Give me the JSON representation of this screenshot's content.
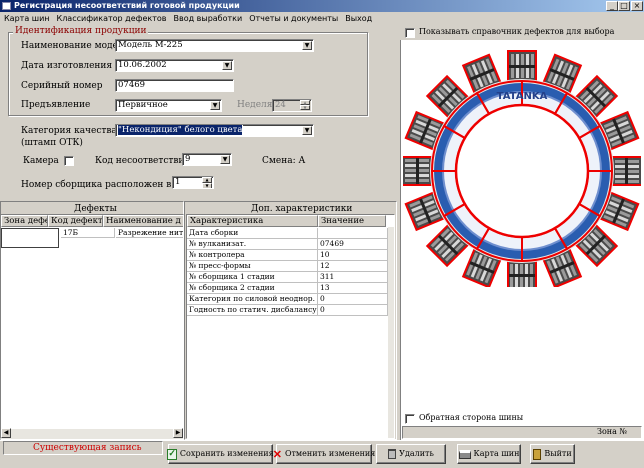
{
  "window": {
    "title": "Регистрация несоответствий готовой продукции",
    "controls": [
      "_",
      "□",
      "×"
    ]
  },
  "menu": [
    "Карта шин",
    "Классификатор дефектов",
    "Ввод выработки",
    "Отчеты и документы",
    "Выход"
  ],
  "identification": {
    "legend": "Идентификация продукции",
    "model_label": "Наименование модели",
    "model_value": "Модель М-225",
    "date_label": "Дата изготовления",
    "date_value": "10.06.2002",
    "serial_label": "Серийный номер",
    "serial_value": "07469",
    "presentation_label": "Предъявление",
    "presentation_value": "Первичное",
    "week_label": "Неделя",
    "week_value": "24"
  },
  "quality": {
    "label_line1": "Категория качества",
    "label_line2": "(штамп ОТК)",
    "value": "\"Некондиция\" белого цвета"
  },
  "camera_label": "Камера",
  "nonconformity": {
    "label": "Код несоответствия",
    "value": "9"
  },
  "shift_label": "Смена: А",
  "assembler": {
    "label": "Номер сборщика расположен в зоне",
    "value": "1"
  },
  "defects": {
    "title": "Дефекты",
    "columns": [
      "Зона дефекта",
      "Код дефекта",
      "Наименование д"
    ],
    "rows": [
      [
        "",
        "17Б",
        "Разрежение нитей"
      ]
    ]
  },
  "extra": {
    "title": "Доп. характеристики",
    "columns": [
      "Характеристика",
      "Значение"
    ],
    "rows": [
      [
        "Дата сборки",
        ""
      ],
      [
        "№ вулканизат.",
        "07469"
      ],
      [
        "№ контролера",
        "10"
      ],
      [
        "№ пресс-формы",
        "12"
      ],
      [
        "№ сборщика 1 стадии",
        "311"
      ],
      [
        "№ сборщика 2 стадии",
        "13"
      ],
      [
        "Категория по силовой неоднор.",
        "0"
      ],
      [
        "Годность по статич. дисбалансу",
        "0"
      ]
    ]
  },
  "right_panel": {
    "show_defects_label": "Показывать справочник дефектов для выбора",
    "tire_brand_text": "TATANKA",
    "back_side_label": "Обратная сторона шины",
    "zone_label": "Зона №"
  },
  "status": {
    "text": "Существующая запись",
    "color": "#cc0000"
  },
  "buttons": {
    "save": "Сохранить изменения",
    "cancel": "Отменить изменения",
    "delete": "Удалить",
    "tire_map": "Карта шин",
    "exit": "Выйти"
  }
}
